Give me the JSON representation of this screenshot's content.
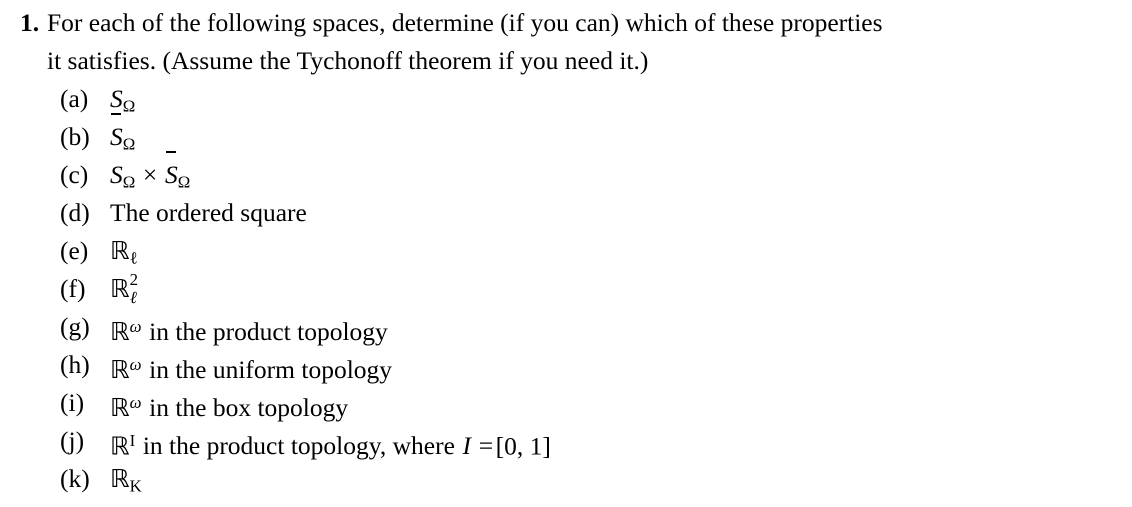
{
  "problem": {
    "number": "1.",
    "stem_line_1": "For each of the following spaces, determine (if you can) which of these properties",
    "stem_line_2": "it satisfies. (Assume the Tychonoff theorem if you need it.)",
    "stem_full": "For each of the following spaces, determine (if you can) which of these properties it satisfies. (Assume the Tychonoff theorem if you need it.)"
  },
  "subitems": [
    {
      "label": "(a)",
      "text": "SΩ",
      "base": "S",
      "subscript": "Ω",
      "overbar": false,
      "trailing": ""
    },
    {
      "label": "(b)",
      "text": "S̄Ω",
      "base": "S",
      "subscript": "Ω",
      "overbar": true,
      "trailing": ""
    },
    {
      "label": "(c)",
      "text": "SΩ × S̄Ω",
      "base": "S",
      "subscript": "Ω",
      "operator": "×",
      "base2": "S",
      "subscript2": "Ω",
      "trailing": ""
    },
    {
      "label": "(d)",
      "text": "The ordered square"
    },
    {
      "label": "(e)",
      "text": "ℝℓ",
      "base": "ℝ",
      "subscript": "ℓ",
      "trailing": ""
    },
    {
      "label": "(f)",
      "text": "ℝ2ℓ",
      "base": "ℝ",
      "superscript": "2",
      "subscript": "ℓ",
      "trailing": ""
    },
    {
      "label": "(g)",
      "text": "ℝω in the product topology",
      "base": "ℝ",
      "superscript": "ω",
      "trailing": "in the product topology"
    },
    {
      "label": "(h)",
      "text": "ℝω in the uniform topology",
      "base": "ℝ",
      "superscript": "ω",
      "trailing": "in the uniform topology"
    },
    {
      "label": "(i)",
      "text": "ℝω in the box topology",
      "base": "ℝ",
      "superscript": "ω",
      "trailing": "in the box topology"
    },
    {
      "label": "(j)",
      "text": "ℝI in the product topology, where I = [0, 1]",
      "base": "ℝ",
      "superscript": "I",
      "trailing": "in the product topology, where",
      "variable": "I",
      "equals": "=",
      "interval": "[0, 1]"
    },
    {
      "label": "(k)",
      "text": "ℝK",
      "base": "ℝ",
      "subscript": "K",
      "trailing": ""
    }
  ]
}
